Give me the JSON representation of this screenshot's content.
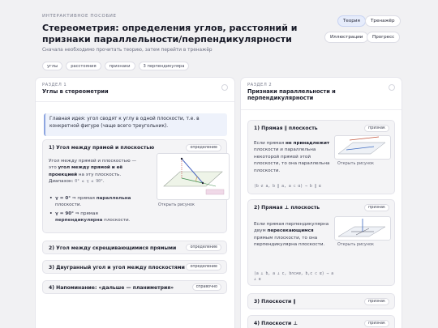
{
  "header": {
    "eyebrow": "ИНТЕРАКТИВНОЕ ПОСОБИЕ",
    "title": "Стереометрия: определения углов, расстояний и признаки параллельности/перпендикулярности",
    "subtitle": "Сначала необходимо прочитать теорию, затем перейти в тренажёр",
    "tags": [
      "углы",
      "расстояния",
      "признаки",
      "3 перпендикуляра"
    ]
  },
  "nav": {
    "theory": "Теория",
    "trainer": "Тренажёр",
    "illustrations": "Иллюстрации",
    "progress": "Прогресс"
  },
  "section1": {
    "label": "РАЗДЕЛ 1",
    "title": "Углы в стереометрии",
    "idea": "Главная идея: угол сводят к углу в одной плоскости, т.е. в конкретной фигуре (чаще всего треугольник).",
    "cards": [
      {
        "title": "1) Угол между прямой и плоскостью",
        "badge": "определение",
        "text_a": "Угол между прямой и плоскостью — это ",
        "text_b": "угол между прямой и её проекцией",
        "text_c": " на эту плоскость. Диапазон: ",
        "range": "0° ≤ γ ≤ 90°",
        "text_d": ".",
        "b1_a": "γ = 0°",
        "b1_b": " ⇒ прямая ",
        "b1_c": "параллельна",
        "b1_d": " плоскости.",
        "b2_a": "γ = 90°",
        "b2_b": " ⇒ прямая ",
        "b2_c": "перпендикулярна",
        "b2_d": " плоскости.",
        "fig_caption": "Открыть рисунок"
      },
      {
        "title": "2) Угол между скрещивающимися прямыми",
        "badge": "определение"
      },
      {
        "title": "3) Двугранный угол и угол между плоскостями",
        "badge": "определение"
      },
      {
        "title": "4) Напоминание: «дальше — планиметрия»",
        "badge": "справочно"
      }
    ]
  },
  "section2": {
    "label": "РАЗДЕЛ 2",
    "title": "Признаки параллельности и перпендикулярности",
    "cards": [
      {
        "title": "1) Прямая ∥ плоскость",
        "badge": "признак",
        "t1": "Если прямая ",
        "t2": "не принадлежит",
        "t3": " плоскости и параллельна некоторой прямой этой плоскости, то она параллельна плоскости.",
        "formula": "(b ⊄ a, b ∥ a, a ⊂ α) ⇒ b ∥ α",
        "fig_caption": "Открыть рисунок"
      },
      {
        "title": "2) Прямая ⊥ плоскость",
        "badge": "признак",
        "t1": "Если прямая перпендикулярна двум ",
        "t2": "пересекающимся",
        "t3": " прямым плоскости, то она перпендикулярна плоскости.",
        "formula": "(a ⊥ b, a ⊥ c, b∩c≠∅, b,c ⊂ α) ⇒ a ⊥ α",
        "fig_caption": "Открыть рисунок"
      },
      {
        "title": "3) Плоскости ∥",
        "badge": "признак"
      },
      {
        "title": "4) Плоскости ⊥",
        "badge": "признак"
      }
    ]
  }
}
